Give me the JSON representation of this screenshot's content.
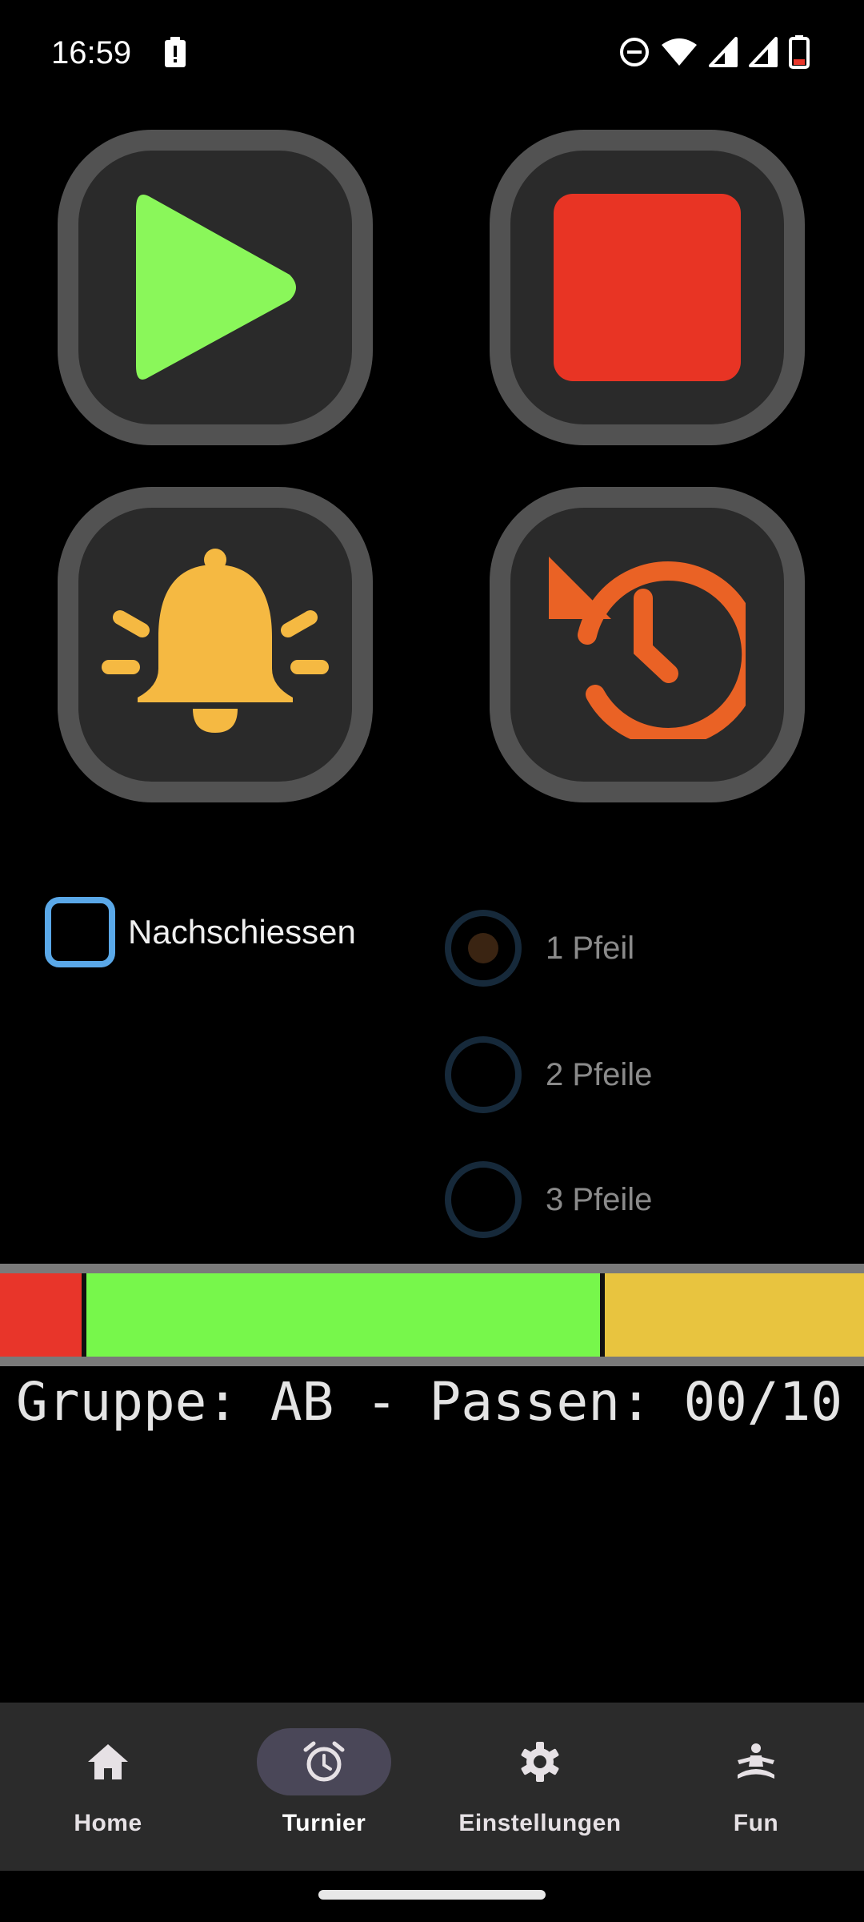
{
  "status_bar": {
    "time": "16:59",
    "icons": [
      "alert-icon",
      "do-not-disturb-icon",
      "wifi-icon",
      "signal-icon",
      "signal-icon",
      "battery-icon"
    ]
  },
  "controls": {
    "play": {
      "icon": "play-icon",
      "color": "#8af75a"
    },
    "stop": {
      "icon": "stop-icon",
      "color": "#e83424"
    },
    "bell": {
      "icon": "bell-icon",
      "color": "#f5b942"
    },
    "reset": {
      "icon": "history-icon",
      "color": "#ea6225"
    }
  },
  "options": {
    "nachschiessen_label": "Nachschiessen",
    "nachschiessen_checked": false,
    "arrows": [
      {
        "label": "1 Pfeil",
        "selected": true
      },
      {
        "label": "2 Pfeile",
        "selected": false
      },
      {
        "label": "3 Pfeile",
        "selected": false
      }
    ]
  },
  "timer_bar": {
    "colors": {
      "red": "#e8352a",
      "green": "#77f74b",
      "yellow": "#e8c43f"
    }
  },
  "status_line": "Gruppe: AB - Passen: 00/10",
  "bottom_nav": {
    "items": [
      {
        "label": "Home",
        "icon": "home-icon",
        "active": false
      },
      {
        "label": "Turnier",
        "icon": "alarm-clock-icon",
        "active": true
      },
      {
        "label": "Einstellungen",
        "icon": "gear-icon",
        "active": false
      },
      {
        "label": "Fun",
        "icon": "meditation-icon",
        "active": false
      }
    ]
  }
}
